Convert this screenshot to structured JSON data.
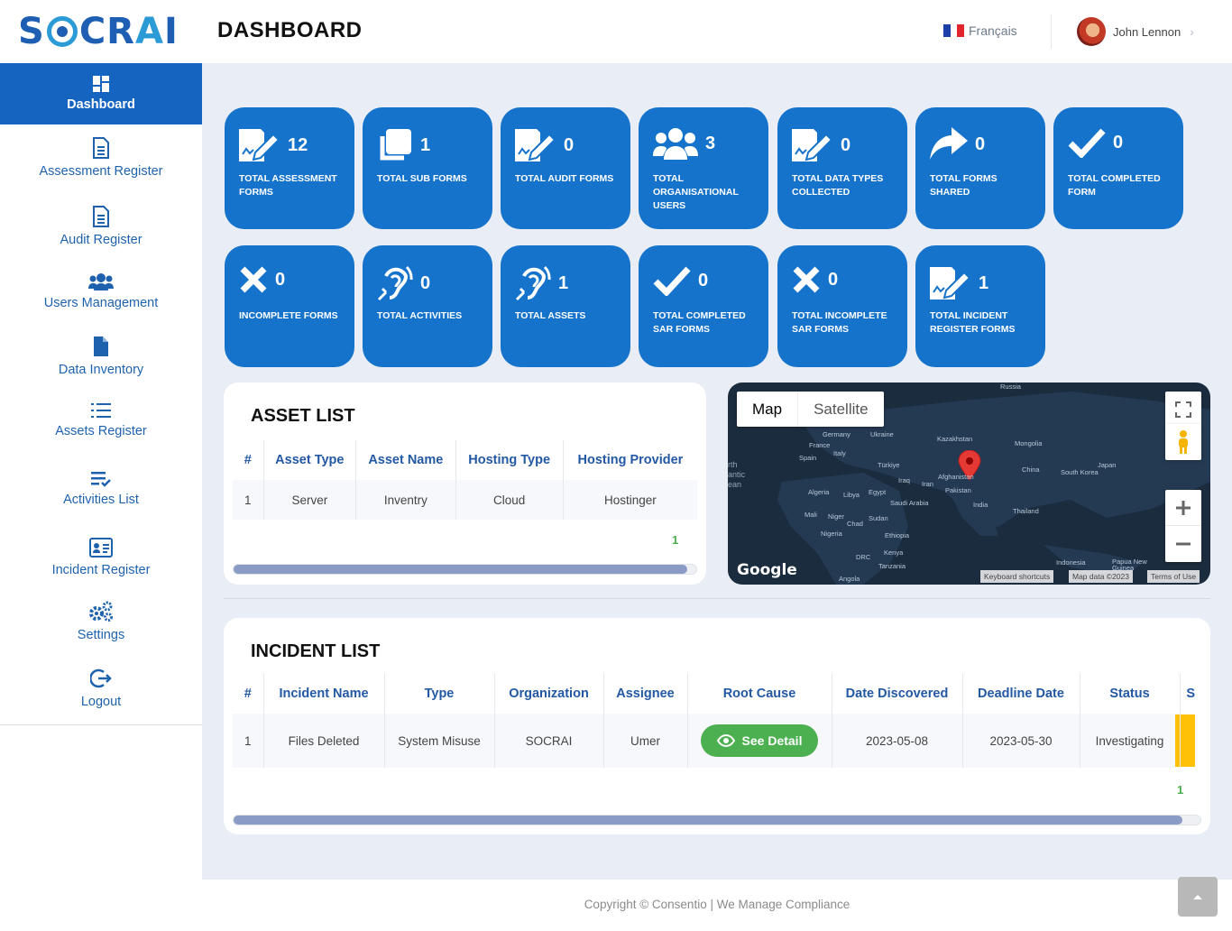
{
  "header": {
    "logo_text": "SOCRAI",
    "page_title": "DASHBOARD",
    "language": "Français",
    "user_name": "John Lennon"
  },
  "sidebar": {
    "items": [
      {
        "label": "Dashboard",
        "icon": "dashboard-grid-icon",
        "active": true
      },
      {
        "label": "Assessment Register",
        "icon": "document-icon"
      },
      {
        "label": "Audit Register",
        "icon": "document-icon"
      },
      {
        "label": "Users Management",
        "icon": "users-icon"
      },
      {
        "label": "Data Inventory",
        "icon": "file-icon"
      },
      {
        "label": "Assets Register",
        "icon": "list-icon"
      },
      {
        "label": "Activities List",
        "icon": "checklist-icon"
      },
      {
        "label": "Incident Register",
        "icon": "id-card-icon"
      },
      {
        "label": "Settings",
        "icon": "gears-icon"
      },
      {
        "label": "Logout",
        "icon": "logout-icon"
      }
    ]
  },
  "tiles": [
    {
      "count": "12",
      "label": "TOTAL ASSESSMENT FORMS",
      "icon": "signature-icon"
    },
    {
      "count": "1",
      "label": "TOTAL SUB FORMS",
      "icon": "copy-icon"
    },
    {
      "count": "0",
      "label": "TOTAL AUDIT FORMS",
      "icon": "signature-icon"
    },
    {
      "count": "3",
      "label": "TOTAL ORGANISATIONAL USERS",
      "icon": "users-icon"
    },
    {
      "count": "0",
      "label": "TOTAL DATA TYPES COLLECTED",
      "icon": "signature-icon"
    },
    {
      "count": "0",
      "label": "TOTAL FORMS SHARED",
      "icon": "share-icon"
    },
    {
      "count": "0",
      "label": "TOTAL COMPLETED FORM",
      "icon": "check-icon"
    },
    {
      "count": "0",
      "label": "INCOMPLETE FORMS",
      "icon": "x-icon"
    },
    {
      "count": "0",
      "label": "TOTAL ACTIVITIES",
      "icon": "ear-icon"
    },
    {
      "count": "1",
      "label": "TOTAL ASSETS",
      "icon": "ear-icon"
    },
    {
      "count": "0",
      "label": "TOTAL COMPLETED SAR FORMS",
      "icon": "check-icon"
    },
    {
      "count": "0",
      "label": "TOTAL INCOMPLETE SAR FORMS",
      "icon": "x-icon"
    },
    {
      "count": "1",
      "label": "TOTAL INCIDENT REGISTER FORMS",
      "icon": "signature-icon"
    }
  ],
  "asset_list": {
    "title": "ASSET LIST",
    "columns": [
      "#",
      "Asset Type",
      "Asset Name",
      "Hosting Type",
      "Hosting Provider"
    ],
    "rows": [
      [
        "1",
        "Server",
        "Inventry",
        "Cloud",
        "Hostinger"
      ]
    ],
    "page": "1"
  },
  "map": {
    "tab_map": "Map",
    "tab_satellite": "Satellite",
    "google": "Google",
    "footer_links": [
      "Keyboard shortcuts",
      "Map data ©2023",
      "Terms of Use"
    ],
    "labels": [
      "Russia",
      "Germany",
      "Ukraine",
      "Kazakhstan",
      "Mongolia",
      "France",
      "Italy",
      "Spain",
      "Türkiye",
      "Japan",
      "China",
      "South Korea",
      "Iraq",
      "Iran",
      "Afghanistan",
      "Pakistan",
      "Algeria",
      "Libya",
      "Egypt",
      "Saudi Arabia",
      "India",
      "Mali",
      "Niger",
      "Chad",
      "Sudan",
      "Thailand",
      "Nigeria",
      "Ethiopia",
      "DRC",
      "Kenya",
      "Tanzania",
      "Indonesia",
      "Papua New Guinea",
      "Angola"
    ],
    "ocean_label": "rth antic ean"
  },
  "incident_list": {
    "title": "INCIDENT LIST",
    "columns": [
      "#",
      "Incident Name",
      "Type",
      "Organization",
      "Assignee",
      "Root Cause",
      "Date Discovered",
      "Deadline Date",
      "Status",
      "S"
    ],
    "rows": [
      {
        "num": "1",
        "name": "Files Deleted",
        "type": "System Misuse",
        "org": "SOCRAI",
        "assignee": "Umer",
        "root_cause": "See Detail",
        "discovered": "2023-05-08",
        "deadline": "2023-05-30",
        "status": "Investigating"
      }
    ],
    "page": "1"
  },
  "footer": {
    "text": "Copyright © Consentio | We Manage Compliance"
  },
  "colors": {
    "primary": "#1673cb",
    "sidebar_active": "#1565c0",
    "accent_green": "#4caf50",
    "severity": "#ffc107"
  }
}
